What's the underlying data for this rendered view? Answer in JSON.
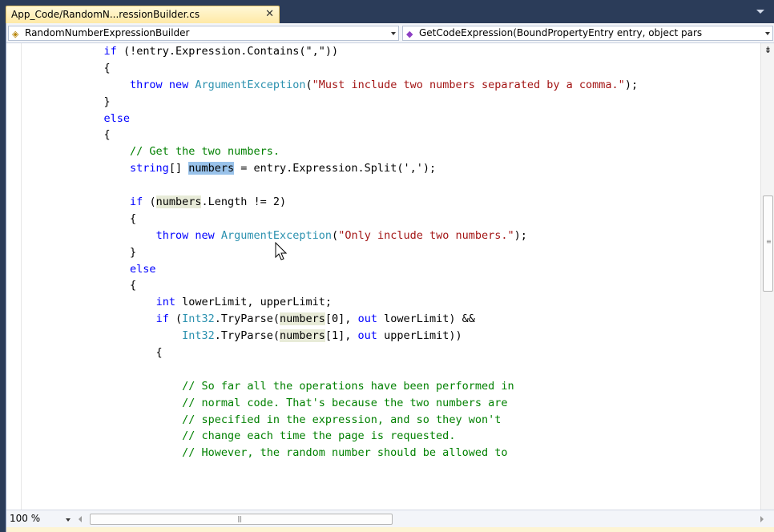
{
  "tab": {
    "title": "App_Code/RandomN...ressionBuilder.cs",
    "close_glyph": "✕"
  },
  "navbar": {
    "type_combo": {
      "label": "RandomNumberExpressionBuilder",
      "icon": "class-icon"
    },
    "member_combo": {
      "label": "GetCodeExpression(BoundPropertyEntry entry, object pars",
      "icon": "method-icon"
    }
  },
  "code_lines": [
    [
      {
        "t": "            "
      },
      {
        "t": "if",
        "c": "kw"
      },
      {
        "t": " (!entry.Expression.Contains(\",\"))"
      }
    ],
    [
      {
        "t": "            {"
      }
    ],
    [
      {
        "t": "                "
      },
      {
        "t": "throw",
        "c": "kw"
      },
      {
        "t": " "
      },
      {
        "t": "new",
        "c": "kw"
      },
      {
        "t": " "
      },
      {
        "t": "ArgumentException",
        "c": "ty"
      },
      {
        "t": "("
      },
      {
        "t": "\"Must include two numbers separated by a comma.\"",
        "c": "st"
      },
      {
        "t": ");"
      }
    ],
    [
      {
        "t": "            }"
      }
    ],
    [
      {
        "t": "            "
      },
      {
        "t": "else",
        "c": "kw"
      }
    ],
    [
      {
        "t": "            {"
      }
    ],
    [
      {
        "t": "                "
      },
      {
        "t": "// Get the two numbers.",
        "c": "cm"
      }
    ],
    [
      {
        "t": "                "
      },
      {
        "t": "string",
        "c": "kw"
      },
      {
        "t": "[] "
      },
      {
        "t": "numbers",
        "c": "hl-sel"
      },
      {
        "t": " = entry.Expression.Split(','"
      },
      {
        "t": ");"
      }
    ],
    [
      {
        "t": ""
      }
    ],
    [
      {
        "t": "                "
      },
      {
        "t": "if",
        "c": "kw"
      },
      {
        "t": " ("
      },
      {
        "t": "numbers",
        "c": "hl-ref"
      },
      {
        "t": ".Length != 2)"
      }
    ],
    [
      {
        "t": "                {"
      }
    ],
    [
      {
        "t": "                    "
      },
      {
        "t": "throw",
        "c": "kw"
      },
      {
        "t": " "
      },
      {
        "t": "new",
        "c": "kw"
      },
      {
        "t": " "
      },
      {
        "t": "ArgumentException",
        "c": "ty"
      },
      {
        "t": "("
      },
      {
        "t": "\"Only include two numbers.\"",
        "c": "st"
      },
      {
        "t": ");"
      }
    ],
    [
      {
        "t": "                }"
      }
    ],
    [
      {
        "t": "                "
      },
      {
        "t": "else",
        "c": "kw"
      }
    ],
    [
      {
        "t": "                {"
      }
    ],
    [
      {
        "t": "                    "
      },
      {
        "t": "int",
        "c": "kw"
      },
      {
        "t": " lowerLimit, upperLimit;"
      }
    ],
    [
      {
        "t": "                    "
      },
      {
        "t": "if",
        "c": "kw"
      },
      {
        "t": " ("
      },
      {
        "t": "Int32",
        "c": "ty"
      },
      {
        "t": ".TryParse("
      },
      {
        "t": "numbers",
        "c": "hl-ref"
      },
      {
        "t": "[0], "
      },
      {
        "t": "out",
        "c": "kw"
      },
      {
        "t": " lowerLimit) &&"
      }
    ],
    [
      {
        "t": "                        "
      },
      {
        "t": "Int32",
        "c": "ty"
      },
      {
        "t": ".TryParse("
      },
      {
        "t": "numbers",
        "c": "hl-ref"
      },
      {
        "t": "[1], "
      },
      {
        "t": "out",
        "c": "kw"
      },
      {
        "t": " upperLimit))"
      }
    ],
    [
      {
        "t": "                    {"
      }
    ],
    [
      {
        "t": ""
      }
    ],
    [
      {
        "t": "                        "
      },
      {
        "t": "// So far all the operations have been performed in",
        "c": "cm"
      }
    ],
    [
      {
        "t": "                        "
      },
      {
        "t": "// normal code. That's because the two numbers are",
        "c": "cm"
      }
    ],
    [
      {
        "t": "                        "
      },
      {
        "t": "// specified in the expression, and so they won't",
        "c": "cm"
      }
    ],
    [
      {
        "t": "                        "
      },
      {
        "t": "// change each time the page is requested.",
        "c": "cm"
      }
    ],
    [
      {
        "t": "                        "
      },
      {
        "t": "// However, the random number should be allowed to",
        "c": "cm"
      }
    ]
  ],
  "bottombar": {
    "zoom_label": "100 %"
  }
}
